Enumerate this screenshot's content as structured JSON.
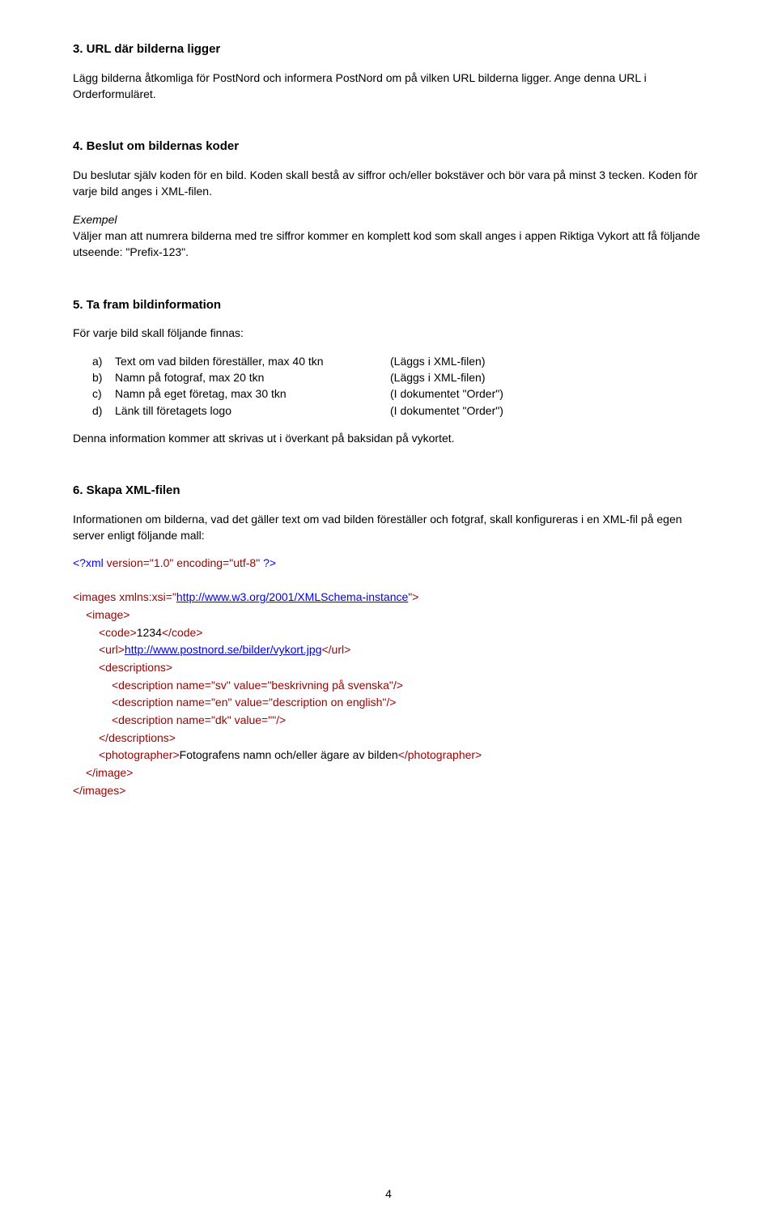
{
  "s3": {
    "heading": "3. URL där bilderna ligger",
    "p1": "Lägg bilderna åtkomliga för PostNord och informera PostNord om på vilken URL bilderna ligger. Ange denna URL i Orderformuläret."
  },
  "s4": {
    "heading": "4. Beslut om bildernas koder",
    "p1": "Du beslutar själv koden för en bild. Koden skall bestå av siffror och/eller bokstäver och bör vara på minst 3 tecken. Koden för varje bild anges i XML-filen.",
    "ex_label": "Exempel",
    "ex_body": "Väljer man att numrera bilderna med tre siffror kommer en komplett kod som skall anges i appen Riktiga Vykort att få följande utseende: \"Prefix-123\"."
  },
  "s5": {
    "heading": "5. Ta fram bildinformation",
    "intro": "För varje bild skall följande finnas:",
    "items": [
      {
        "label": "a)",
        "text": "Text om vad bilden föreställer, max 40 tkn",
        "note": "(Läggs i XML-filen)"
      },
      {
        "label": "b)",
        "text": "Namn på fotograf, max 20 tkn",
        "note": "(Läggs i XML-filen)"
      },
      {
        "label": "c)",
        "text": "Namn på eget företag, max 30 tkn",
        "note": "(I dokumentet \"Order\")"
      },
      {
        "label": "d)",
        "text": "Länk till företagets logo",
        "note": "(I dokumentet \"Order\")"
      }
    ],
    "outro": "Denna information kommer att skrivas ut i överkant på baksidan på vykortet."
  },
  "s6": {
    "heading": "6. Skapa XML-filen",
    "p1": "Informationen om bilderna, vad det gäller text om vad bilden föreställer och fotgraf, skall konfigureras i en XML-fil på egen server enligt följande mall:"
  },
  "xml": {
    "decl_open": "<?xml ",
    "decl_attr_version": "version=\"1.0\" ",
    "decl_attr_encoding": "encoding=\"utf-8\" ",
    "decl_close": "?>",
    "images_open_pre": "<images ",
    "images_xmlns": "xmlns:xsi=\"",
    "images_xmlns_url": "http://www.w3.org/2001/XMLSchema-instance",
    "images_open_post": "\">",
    "image_open": "<image>",
    "code_open": "<code>",
    "code_val": "1234",
    "code_close": "</code>",
    "url_open": "<url>",
    "url_val": "http://www.postnord.se/bilder/vykort.jpg",
    "url_close": "</url>",
    "descs_open": "<descriptions>",
    "desc_sv": "<description name=\"sv\" value=\"beskrivning på svenska\"/>",
    "desc_en": "<description name=\"en\" value=\"description on english\"/>",
    "desc_dk": "<description name=\"dk\" value=\"\"/>",
    "descs_close": "</descriptions>",
    "photog_open": "<photographer>",
    "photog_val": "Fotografens namn och/eller ägare av bilden",
    "photog_close": "</photographer>",
    "image_close": "</image>",
    "images_close": "</images>"
  },
  "page_number": "4"
}
